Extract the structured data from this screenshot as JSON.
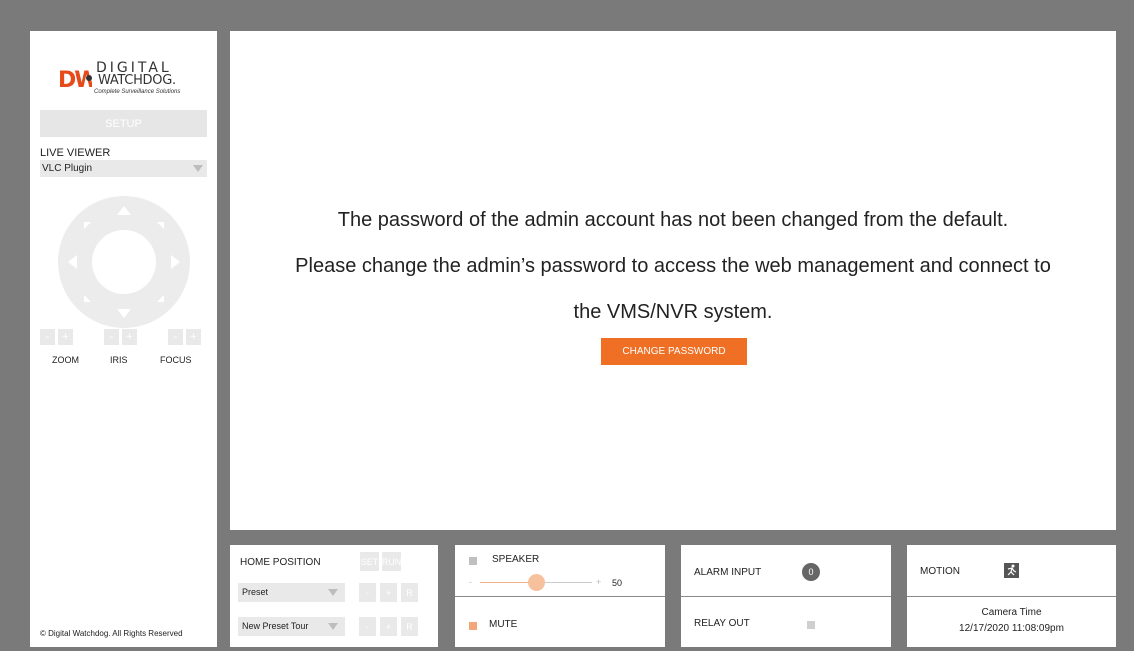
{
  "brand": {
    "logo_mark": "DW",
    "name_line1": "DIGITAL",
    "name_line2": "WATCHDOG.",
    "tagline": "Complete Surveillance Solutions"
  },
  "sidebar": {
    "setup_label": "SETUP",
    "live_viewer_label": "LIVE VIEWER",
    "live_viewer_value": "VLC Plugin",
    "ptz_icon": "ptz-directional-pad",
    "minus": "-",
    "plus": "+",
    "zoom_label": "ZOOM",
    "iris_label": "IRIS",
    "focus_label": "FOCUS",
    "copyright": "© Digital Watchdog. All Rights Reserved"
  },
  "main": {
    "message_line1": "The password of the admin account has not been changed from the default.",
    "message_line2": "Please change the admin’s password to access the web management and connect to",
    "message_line3": "the VMS/NVR system.",
    "change_password_label": "CHANGE PASSWORD"
  },
  "home_panel": {
    "home_position_label": "HOME POSITION",
    "set_label": "SET",
    "run_label": "RUN",
    "preset_value": "Preset",
    "preset_tour_value": "New Preset Tour",
    "minus": "-",
    "plus": "+",
    "r_label": "R"
  },
  "audio_panel": {
    "speaker_label": "SPEAKER",
    "speaker_checked": false,
    "volume_min": "-",
    "volume_max": "+",
    "volume_value": "50",
    "volume_level": 0.5,
    "mute_label": "MUTE",
    "mute_checked": true
  },
  "io_panel": {
    "alarm_input_label": "ALARM INPUT",
    "alarm_input_count": "0",
    "relay_out_label": "RELAY OUT",
    "relay_out_checked": false
  },
  "status_panel": {
    "motion_label": "MOTION",
    "motion_icon": "running-person-icon",
    "camera_time_label": "Camera Time",
    "camera_time_value": "12/17/2020 11:08:09pm"
  },
  "colors": {
    "accent": "#ef6f24",
    "frame": "#7a7a7a",
    "button_disabled": "#e9e9e9"
  }
}
